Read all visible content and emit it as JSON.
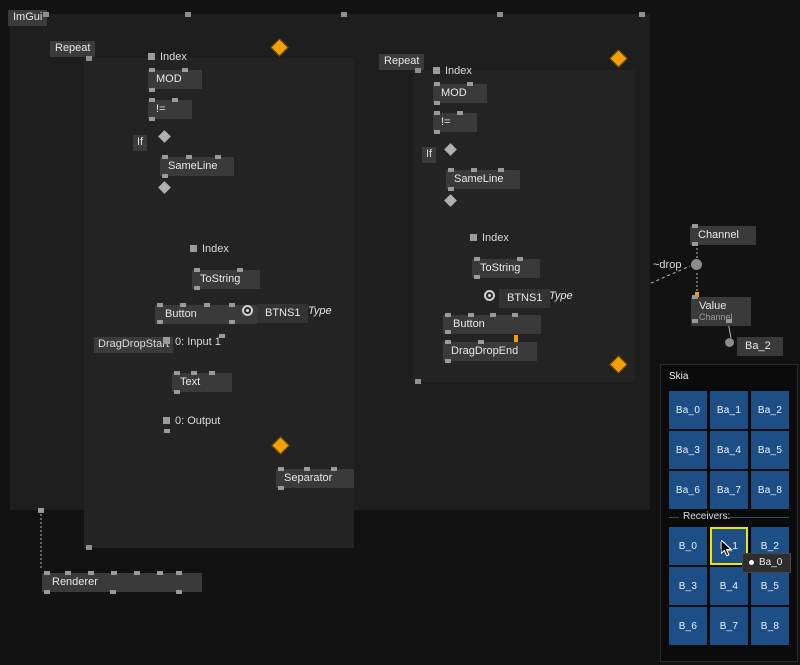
{
  "app": {
    "title": "ImGui"
  },
  "groups": [
    {
      "name": "imgui-container",
      "label": "ImGui"
    },
    {
      "name": "repeat-left",
      "label": "Repeat"
    },
    {
      "name": "repeat-right",
      "label": "Repeat"
    }
  ],
  "left_graph": {
    "index_1": "Index",
    "mod": "MOD",
    "neq": "!=",
    "if": "If",
    "sameline": "SameLine",
    "index_2": "Index",
    "tostring": "ToString",
    "button": "Button",
    "btns_field": "BTNS1",
    "type_label": "Type",
    "dragdropstart": "DragDropStart",
    "input_pin": "0: Input 1",
    "text": "Text",
    "output_pin": "0: Output",
    "separator": "Separator"
  },
  "right_graph": {
    "index_1": "Index",
    "mod": "MOD",
    "neq": "!=",
    "if": "If",
    "sameline": "SameLine",
    "index_2": "Index",
    "tostring": "ToString",
    "button": "Button",
    "btns_field": "BTNS1",
    "type_label": "Type",
    "dragdropend": "DragDropEnd"
  },
  "channel_graph": {
    "channel": "Channel",
    "drop_label": "~drop",
    "value": "Value",
    "value_sub": "Channel",
    "ba_2": "Ba_2"
  },
  "renderer": {
    "label": "Renderer"
  },
  "skia_panel": {
    "title": "Skia",
    "senders": [
      "Ba_0",
      "Ba_1",
      "Ba_2",
      "Ba_3",
      "Ba_4",
      "Ba_5",
      "Ba_6",
      "Ba_7",
      "Ba_8"
    ],
    "receivers_label": "Receivers:",
    "receivers": [
      "B_0",
      "B_1",
      "B_2",
      "B_3",
      "B_4",
      "B_5",
      "B_6",
      "B_7",
      "B_8"
    ],
    "selected_receiver": "B_1",
    "drag_tooltip": "Ba_0"
  },
  "colors": {
    "background": "#121212",
    "group_bg": "#1f1f1f",
    "node_bg": "#3a3a3a",
    "flow_pin": "#f2a003",
    "button_blue": "#1d4e86",
    "selection_yellow": "#f2e400",
    "link": "#b9b9b9"
  }
}
